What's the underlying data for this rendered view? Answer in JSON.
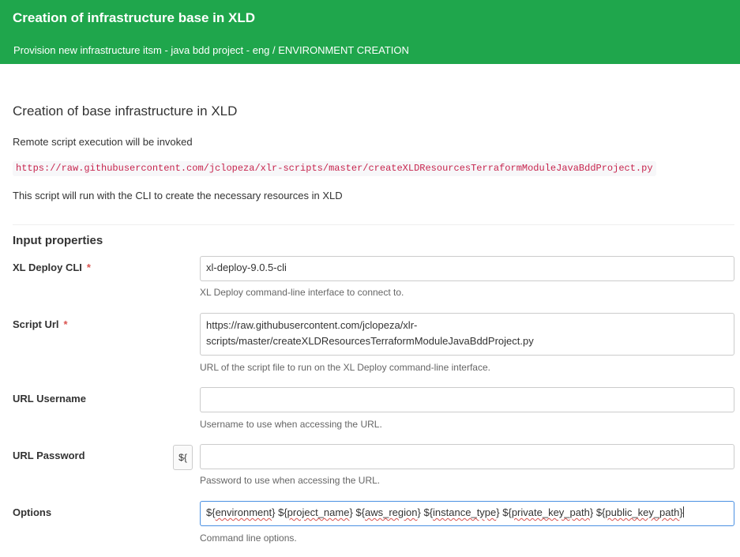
{
  "header": {
    "title": "Creation of infrastructure base in XLD",
    "breadcrumb": "Provision new infrastructure itsm - java bdd project - eng / ENVIRONMENT CREATION"
  },
  "task": {
    "title": "Creation of base infrastructure in XLD",
    "description_line1": "Remote script execution will be invoked",
    "script_url_code": "https://raw.githubusercontent.com/jclopeza/xlr-scripts/master/createXLDResourcesTerraformModuleJavaBddProject.py",
    "description_line3": "This script will run with the CLI to create the necessary resources in XLD"
  },
  "input_properties": {
    "heading": "Input properties",
    "required_marker": "*",
    "xl_deploy_cli": {
      "label": "XL Deploy CLI",
      "value": "xl-deploy-9.0.5-cli",
      "help": "XL Deploy command-line interface to connect to."
    },
    "script_url": {
      "label": "Script Url",
      "value_line1": "https://raw.githubusercontent.com/jclopeza/xlr-",
      "value_line2": "scripts/master/createXLDResourcesTerraformModuleJavaBddProject.py",
      "help": "URL of the script file to run on the XL Deploy command-line interface."
    },
    "url_username": {
      "label": "URL Username",
      "value": "",
      "help": "Username to use when accessing the URL."
    },
    "url_password": {
      "label": "URL Password",
      "variable_button": "${",
      "value": "",
      "help": "Password to use when accessing the URL."
    },
    "options": {
      "label": "Options",
      "tokens": [
        {
          "pre": "${",
          "word": "environment",
          "post": "} "
        },
        {
          "pre": "${",
          "word": "project_name",
          "post": "} "
        },
        {
          "pre": "${",
          "word": "aws_region",
          "post": "} "
        },
        {
          "pre": "${",
          "word": "instance_type",
          "post": "} "
        },
        {
          "pre": "${",
          "word": "private_key_path",
          "post": "} "
        },
        {
          "pre": "${",
          "word": "public_key_path",
          "post": "}"
        }
      ],
      "help": "Command line options."
    }
  },
  "colors": {
    "header_bg": "#1fa64c",
    "required": "#d9534f",
    "code_text": "#c7254e",
    "focus_border": "#4a90e2"
  }
}
